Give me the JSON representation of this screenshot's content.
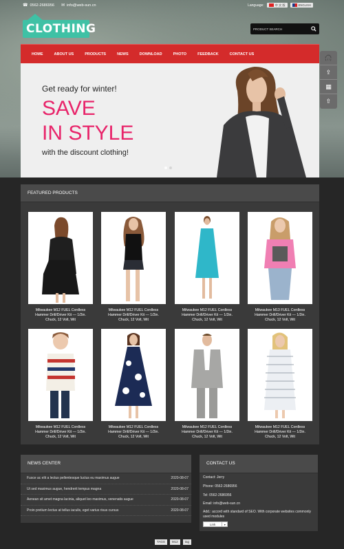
{
  "topbar": {
    "phone": "0562-2686956",
    "email": "info@web-sun.cn",
    "language_label": "Language:",
    "lang_cn": "中 文 版",
    "lang_en": "ENGLISH"
  },
  "logo": {
    "text": "CLOTHING"
  },
  "search": {
    "placeholder": "PRODUCT SEARCH"
  },
  "nav": {
    "items": [
      "HOME",
      "ABOUT US",
      "PRODUCTS",
      "NEWS",
      "DOWNLOAD",
      "PHOTO",
      "FEEDBACK",
      "CONTACT US"
    ]
  },
  "hero": {
    "line1": "Get ready for winter!",
    "line2a": "SAVE",
    "line2b": "IN STYLE",
    "line3": "with the discount clothing!"
  },
  "featured": {
    "title": "FEATURED PRODUCTS",
    "caption": "Milwaukee M12 FUEL Cordless Hammer Drill/Driver Kit — 1/2in. Chuck, 12 Volt, Wit",
    "caption_alt": "Milwaukee M13 FUEL Cordless Hammer Drill/Driver Kit — 1/2in. Chuck, 12 Volt, Wit"
  },
  "news": {
    "title": "NEWS CENTER",
    "items": [
      {
        "title": "Fusce ac elit a lectus pellentesque luctus eu maximus augue",
        "date": "2020-08-07"
      },
      {
        "title": "Ut sed maximus augue, hendrerit tempus magna",
        "date": "2020-08-07"
      },
      {
        "title": "Aenean sit amet magna lacinia, aliquet leo maximus, venenatis augue",
        "date": "2020-08-07"
      },
      {
        "title": "Proin pretium lectus at tellus iaculis, eget varius risus cursus",
        "date": "2020-08-07"
      }
    ]
  },
  "contact": {
    "title": "CONTACT US",
    "contact": "Contact: Jerry",
    "phone": "Phone: 0562-2686956",
    "tel": "Tel: 0562-2686956",
    "email": "Email: info@web-sun.cn",
    "addr": "Add.: accord with standard of SEO. With corporate websites commonly used modules",
    "link_label": "Link"
  },
  "footer": {
    "tags": [
      "TAGS",
      "M12",
      "tag"
    ]
  }
}
